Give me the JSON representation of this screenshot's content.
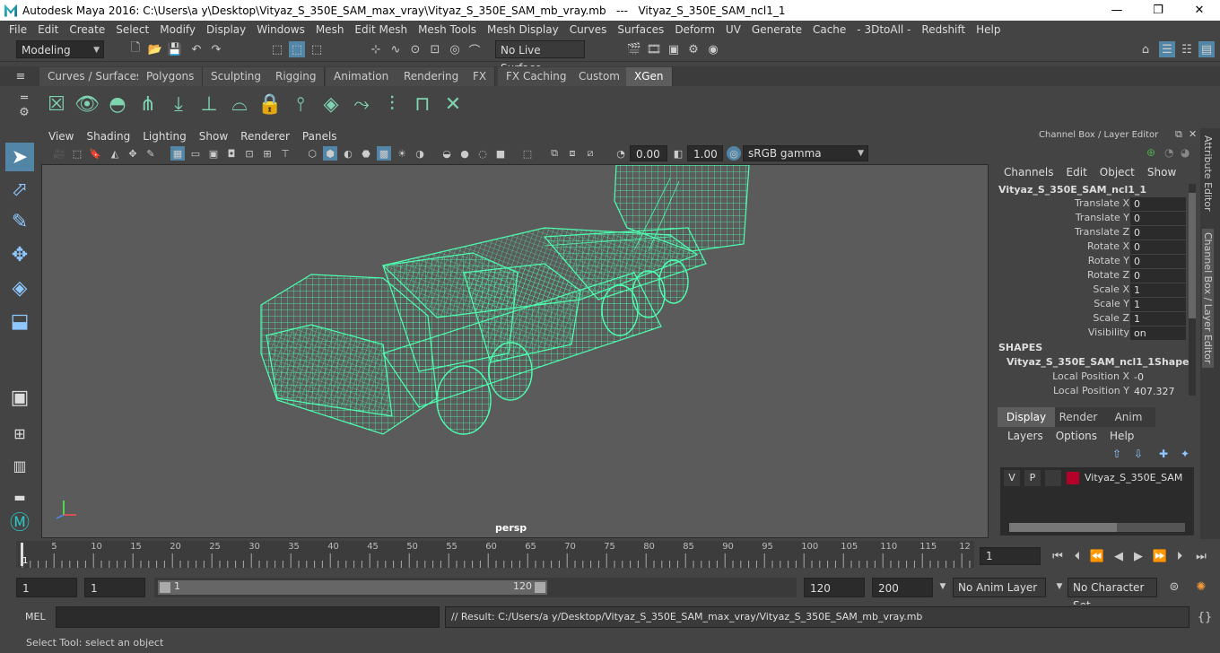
{
  "window": {
    "title": "Autodesk Maya 2016: C:\\Users\\a y\\Desktop\\Vityaz_S_350E_SAM_max_vray\\Vityaz_S_350E_SAM_mb_vray.mb   ---   Vityaz_S_350E_SAM_ncl1_1",
    "min": "—",
    "max": "❐",
    "close": "✕"
  },
  "menu": [
    "File",
    "Edit",
    "Create",
    "Select",
    "Modify",
    "Display",
    "Windows",
    "Mesh",
    "Edit Mesh",
    "Mesh Tools",
    "Mesh Display",
    "Curves",
    "Surfaces",
    "Deform",
    "UV",
    "Generate",
    "Cache",
    "- 3DtoAll -",
    "Redshift",
    "Help"
  ],
  "status": {
    "mode": "Modeling",
    "live_surface": "No Live Surface"
  },
  "shelf_tabs": [
    "Curves / Surfaces",
    "Polygons",
    "Sculpting",
    "Rigging",
    "Animation",
    "Rendering",
    "FX",
    "FX Caching",
    "Custom",
    "XGen"
  ],
  "active_shelf": "XGen",
  "panel_menu": [
    "View",
    "Shading",
    "Lighting",
    "Show",
    "Renderer",
    "Panels"
  ],
  "panel_toolbar": {
    "exposure": "0.00",
    "gamma": "1.00",
    "color_space": "sRGB gamma"
  },
  "viewport": {
    "camera": "persp"
  },
  "channel_box": {
    "header": "Channel Box / Layer Editor",
    "menu": [
      "Channels",
      "Edit",
      "Object",
      "Show"
    ],
    "object": "Vityaz_S_350E_SAM_ncl1_1",
    "attrs": [
      {
        "label": "Translate X",
        "value": "0"
      },
      {
        "label": "Translate Y",
        "value": "0"
      },
      {
        "label": "Translate Z",
        "value": "0"
      },
      {
        "label": "Rotate X",
        "value": "0"
      },
      {
        "label": "Rotate Y",
        "value": "0"
      },
      {
        "label": "Rotate Z",
        "value": "0"
      },
      {
        "label": "Scale X",
        "value": "1"
      },
      {
        "label": "Scale Y",
        "value": "1"
      },
      {
        "label": "Scale Z",
        "value": "1"
      },
      {
        "label": "Visibility",
        "value": "on"
      }
    ],
    "shapes_label": "SHAPES",
    "shape_name": "Vityaz_S_350E_SAM_ncl1_1Shape",
    "shape_attrs": [
      {
        "label": "Local Position X",
        "value": "-0"
      },
      {
        "label": "Local Position Y",
        "value": "407.327"
      }
    ]
  },
  "layer_editor": {
    "tabs": [
      "Display",
      "Render",
      "Anim"
    ],
    "active_tab": "Display",
    "menu": [
      "Layers",
      "Options",
      "Help"
    ],
    "layer": {
      "v": "V",
      "p": "P",
      "name": "Vityaz_S_350E_SAM",
      "color": "#b5002a"
    }
  },
  "side_tabs": [
    "Attribute Editor",
    "Channel Box / Layer Editor"
  ],
  "timeline": {
    "ticks": [
      "5",
      "10",
      "15",
      "20",
      "25",
      "30",
      "35",
      "40",
      "45",
      "50",
      "55",
      "60",
      "65",
      "70",
      "75",
      "80",
      "85",
      "90",
      "95",
      "100",
      "105",
      "110",
      "115",
      "12"
    ],
    "current": "1",
    "current_field": "1"
  },
  "range": {
    "start": "1",
    "start2": "1",
    "slider_start": "1",
    "slider_end": "120",
    "end": "120",
    "end2": "200",
    "anim_layer": "No Anim Layer",
    "char_set": "No Character Set"
  },
  "cmd": {
    "lang": "MEL",
    "result": "// Result: C:/Users/a y/Desktop/Vityaz_S_350E_SAM_max_vray/Vityaz_S_350E_SAM_mb_vray.mb"
  },
  "help": "Select Tool: select an object",
  "colors": {
    "wire": "#4dffb0",
    "accent": "#5285a6"
  }
}
